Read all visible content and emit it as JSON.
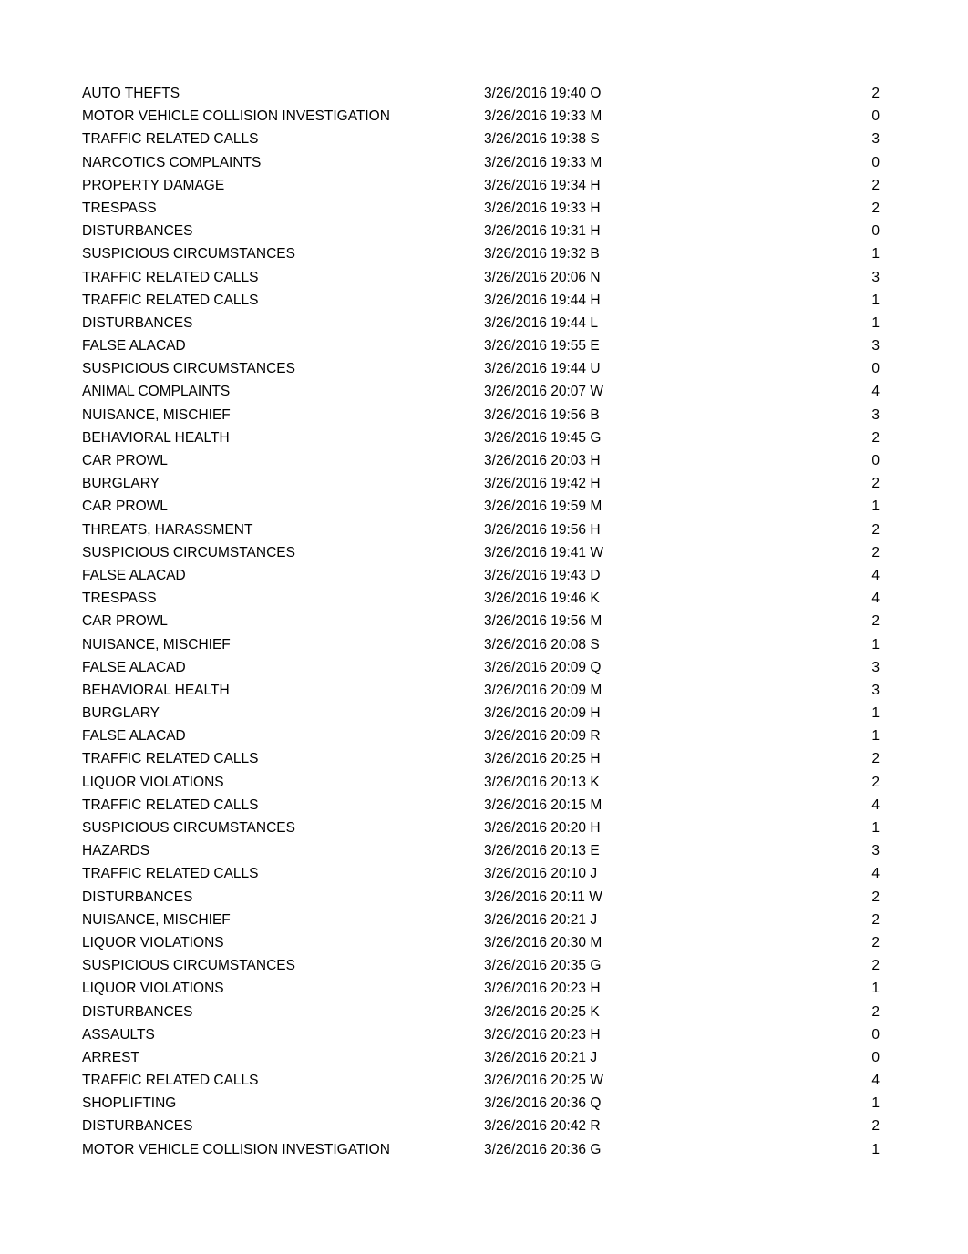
{
  "rows": [
    [
      "AUTO THEFTS",
      "3/26/2016 19:40 O",
      "2"
    ],
    [
      "MOTOR VEHICLE COLLISION INVESTIGATION",
      "3/26/2016 19:33 M",
      "0"
    ],
    [
      "TRAFFIC RELATED CALLS",
      "3/26/2016 19:38 S",
      "3"
    ],
    [
      "NARCOTICS COMPLAINTS",
      "3/26/2016 19:33 M",
      "0"
    ],
    [
      "PROPERTY DAMAGE",
      "3/26/2016 19:34 H",
      "2"
    ],
    [
      "TRESPASS",
      "3/26/2016 19:33 H",
      "2"
    ],
    [
      "DISTURBANCES",
      "3/26/2016 19:31 H",
      "0"
    ],
    [
      "SUSPICIOUS CIRCUMSTANCES",
      "3/26/2016 19:32 B",
      "1"
    ],
    [
      "TRAFFIC RELATED CALLS",
      "3/26/2016 20:06 N",
      "3"
    ],
    [
      "TRAFFIC RELATED CALLS",
      "3/26/2016 19:44 H",
      "1"
    ],
    [
      "DISTURBANCES",
      "3/26/2016 19:44 L",
      "1"
    ],
    [
      "FALSE ALACAD",
      "3/26/2016 19:55 E",
      "3"
    ],
    [
      "SUSPICIOUS CIRCUMSTANCES",
      "3/26/2016 19:44 U",
      "0"
    ],
    [
      "ANIMAL COMPLAINTS",
      "3/26/2016 20:07 W",
      "4"
    ],
    [
      "NUISANCE, MISCHIEF",
      "3/26/2016 19:56 B",
      "3"
    ],
    [
      "BEHAVIORAL HEALTH",
      "3/26/2016 19:45 G",
      "2"
    ],
    [
      "CAR PROWL",
      "3/26/2016 20:03 H",
      "0"
    ],
    [
      "BURGLARY",
      "3/26/2016 19:42 H",
      "2"
    ],
    [
      "CAR PROWL",
      "3/26/2016 19:59 M",
      "1"
    ],
    [
      "THREATS, HARASSMENT",
      "3/26/2016 19:56 H",
      "2"
    ],
    [
      "SUSPICIOUS CIRCUMSTANCES",
      "3/26/2016 19:41 W",
      "2"
    ],
    [
      "FALSE ALACAD",
      "3/26/2016 19:43 D",
      "4"
    ],
    [
      "TRESPASS",
      "3/26/2016 19:46 K",
      "4"
    ],
    [
      "CAR PROWL",
      "3/26/2016 19:56 M",
      "2"
    ],
    [
      "NUISANCE, MISCHIEF",
      "3/26/2016 20:08 S",
      "1"
    ],
    [
      "FALSE ALACAD",
      "3/26/2016 20:09 Q",
      "3"
    ],
    [
      "BEHAVIORAL HEALTH",
      "3/26/2016 20:09 M",
      "3"
    ],
    [
      "BURGLARY",
      "3/26/2016 20:09 H",
      "1"
    ],
    [
      "FALSE ALACAD",
      "3/26/2016 20:09 R",
      "1"
    ],
    [
      "TRAFFIC RELATED CALLS",
      "3/26/2016 20:25 H",
      "2"
    ],
    [
      "LIQUOR VIOLATIONS",
      "3/26/2016 20:13 K",
      "2"
    ],
    [
      "TRAFFIC RELATED CALLS",
      "3/26/2016 20:15 M",
      "4"
    ],
    [
      "SUSPICIOUS CIRCUMSTANCES",
      "3/26/2016 20:20 H",
      "1"
    ],
    [
      "HAZARDS",
      "3/26/2016 20:13 E",
      "3"
    ],
    [
      "TRAFFIC RELATED CALLS",
      "3/26/2016 20:10 J",
      "4"
    ],
    [
      "DISTURBANCES",
      "3/26/2016 20:11 W",
      "2"
    ],
    [
      "NUISANCE, MISCHIEF",
      "3/26/2016 20:21 J",
      "2"
    ],
    [
      "LIQUOR VIOLATIONS",
      "3/26/2016 20:30 M",
      "2"
    ],
    [
      "SUSPICIOUS CIRCUMSTANCES",
      "3/26/2016 20:35 G",
      "2"
    ],
    [
      "LIQUOR VIOLATIONS",
      "3/26/2016 20:23 H",
      "1"
    ],
    [
      "DISTURBANCES",
      "3/26/2016 20:25 K",
      "2"
    ],
    [
      "ASSAULTS",
      "3/26/2016 20:23 H",
      "0"
    ],
    [
      "ARREST",
      "3/26/2016 20:21 J",
      "0"
    ],
    [
      "TRAFFIC RELATED CALLS",
      "3/26/2016 20:25 W",
      "4"
    ],
    [
      "SHOPLIFTING",
      "3/26/2016 20:36 Q",
      "1"
    ],
    [
      "DISTURBANCES",
      "3/26/2016 20:42 R",
      "2"
    ],
    [
      "MOTOR VEHICLE COLLISION INVESTIGATION",
      "3/26/2016 20:36 G",
      "1"
    ]
  ]
}
